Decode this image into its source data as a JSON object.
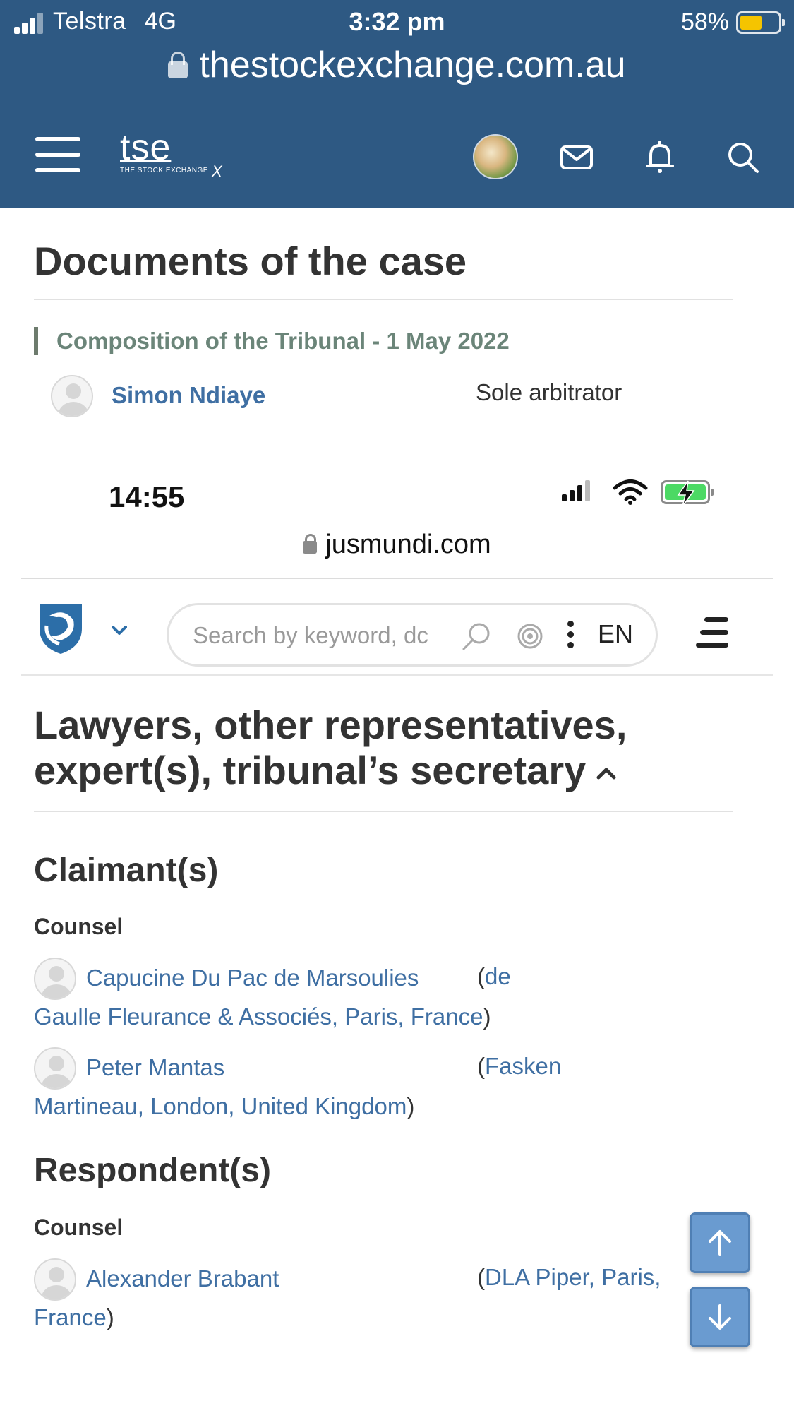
{
  "status_bar": {
    "carrier": "Telstra",
    "network": "4G",
    "time": "3:32 pm",
    "battery_percent": "58%",
    "battery_level": 0.58,
    "battery_color": "#f5c400"
  },
  "browser": {
    "url": "thestockexchange.com.au"
  },
  "site_nav": {
    "menu_icon": "hamburger-icon",
    "logo_main": "tse",
    "logo_sub": "THE STOCK EXCHANGE",
    "logo_suffix": "X",
    "avatar_icon": "user-avatar",
    "mail_icon": "mail-icon",
    "bell_icon": "bell-icon",
    "search_icon": "search-icon",
    "bar_color": "#2e5983"
  },
  "documents": {
    "title": "Documents of the case",
    "tribunal_heading": "Composition of the Tribunal - 1 May 2022",
    "arbitrator_name": "Simon Ndiaye",
    "arbitrator_role": "Sole arbitrator"
  },
  "embedded": {
    "status_time": "14:55",
    "url": "jusmundi.com",
    "search_placeholder": "Search by keyword, dc",
    "language": "EN",
    "section_title": "Lawyers, other representatives, expert(s), tribunal’s secretary",
    "claimants": {
      "title": "Claimant(s)",
      "counsel_label": "Counsel",
      "lawyers": [
        {
          "name": "Capucine Du Pac de Marsoulies",
          "open_paren": "(",
          "firm_first": "de",
          "firm_rest": "Gaulle Fleurance & Associés, Paris, France",
          "close_paren": ")"
        },
        {
          "name": "Peter Mantas",
          "open_paren": "(",
          "firm_first": "Fasken",
          "firm_rest": "Martineau, London, United Kingdom",
          "close_paren": ")"
        }
      ]
    },
    "respondents": {
      "title": "Respondent(s)",
      "counsel_label": "Counsel",
      "lawyers": [
        {
          "name": "Alexander Brabant",
          "open_paren": "(",
          "firm_first": "DLA Piper, Paris,",
          "firm_rest": "France",
          "close_paren": ")"
        }
      ]
    },
    "link_color": "#3f6fa3",
    "scroll_up_icon": "arrow-up-icon",
    "scroll_down_icon": "arrow-down-icon"
  }
}
